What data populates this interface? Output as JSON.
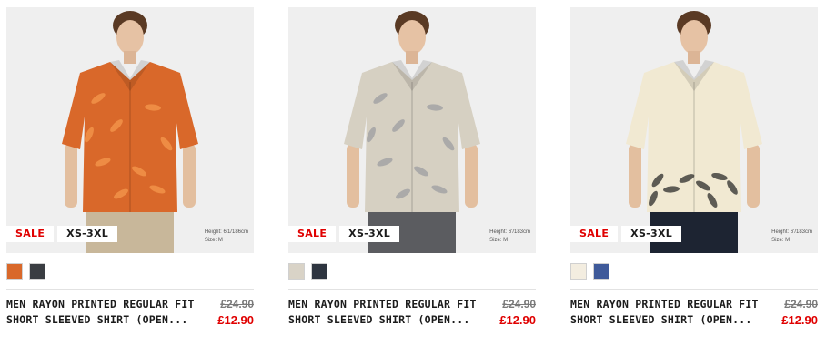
{
  "products": [
    {
      "badge_sale": "SALE",
      "badge_size": "XS-3XL",
      "model_height": "Height: 6'1/186cm",
      "model_size": "Size: M",
      "swatches": [
        {
          "color": "#d9682a",
          "name": "orange-print"
        },
        {
          "color": "#3a3d42",
          "name": "charcoal-print"
        }
      ],
      "name_line1": "MEN RAYON PRINTED REGULAR FIT",
      "name_line2": "SHORT SLEEVED SHIRT (OPEN...",
      "old_price": "£24.90",
      "price": "£12.90",
      "shirt_color": "#d9682a",
      "bottom_color": "#c8b79a"
    },
    {
      "badge_sale": "SALE",
      "badge_size": "XS-3XL",
      "model_height": "Height: 6'/183cm",
      "model_size": "Size: M",
      "swatches": [
        {
          "color": "#d9d3c7",
          "name": "beige-print"
        },
        {
          "color": "#2e3540",
          "name": "navy-print"
        }
      ],
      "name_line1": "MEN RAYON PRINTED REGULAR FIT",
      "name_line2": "SHORT SLEEVED SHIRT (OPEN...",
      "old_price": "£24.90",
      "price": "£12.90",
      "shirt_color": "#d6d0c2",
      "bottom_color": "#5b5c60"
    },
    {
      "badge_sale": "SALE",
      "badge_size": "XS-3XL",
      "model_height": "Height: 6'/183cm",
      "model_size": "Size: M",
      "swatches": [
        {
          "color": "#f3ede0",
          "name": "off-white"
        },
        {
          "color": "#3f5a9a",
          "name": "blue"
        }
      ],
      "name_line1": "MEN RAYON PRINTED REGULAR FIT",
      "name_line2": "SHORT SLEEVED SHIRT (OPEN...",
      "old_price": "£24.90",
      "price": "£12.90",
      "shirt_color": "#f1e9d2",
      "bottom_color": "#1d2432"
    }
  ]
}
